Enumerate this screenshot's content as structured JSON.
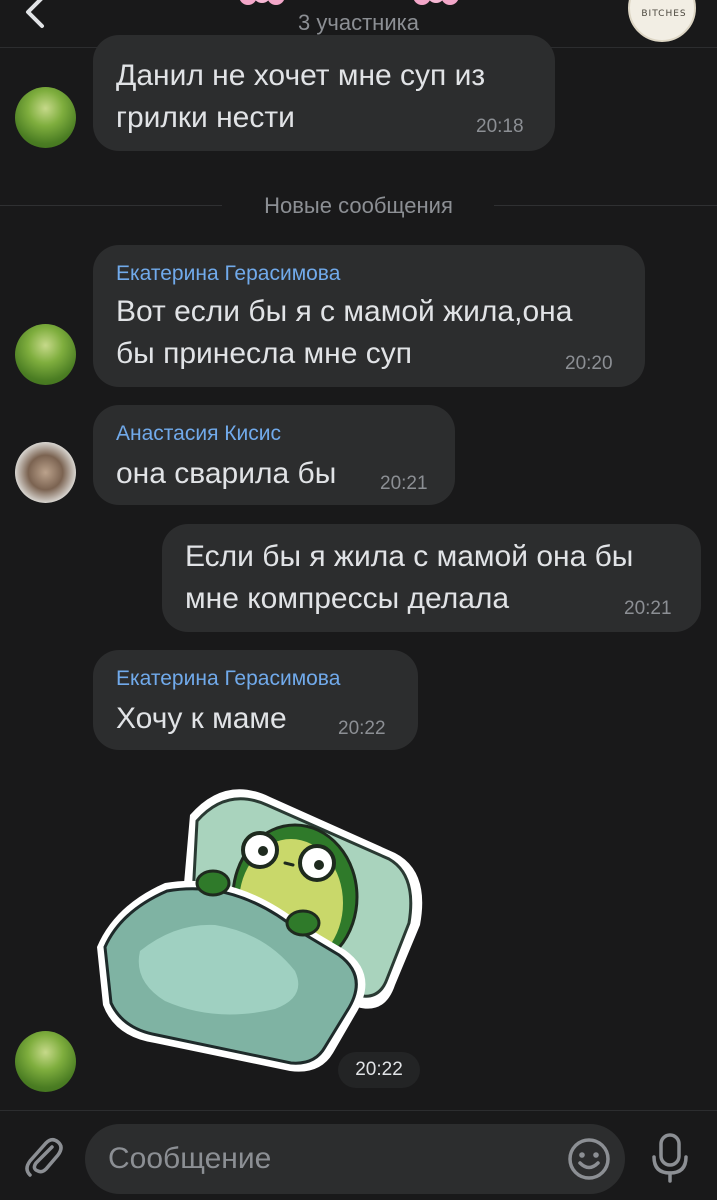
{
  "header": {
    "subtitle": "3 участника",
    "avatar_text": "BITCHES",
    "back_icon": "chevron-left-icon"
  },
  "divider": {
    "label": "Новые сообщения"
  },
  "messages": [
    {
      "text": "Данил не хочет мне суп из\nгрилки нести",
      "time": "20:18"
    },
    {
      "sender": "Екатерина Герасимова",
      "text": "Вот если бы я с мамой жила,она\nбы принесла мне суп",
      "time": "20:20"
    },
    {
      "sender": "Анастасия Кисис",
      "text": "она сварила бы",
      "time": "20:21"
    },
    {
      "text": "Если бы я жила с мамой она бы\nмне компрессы делала",
      "time": "20:21"
    },
    {
      "sender": "Екатерина Герасимова",
      "text": "Хочу к маме",
      "time": "20:22"
    },
    {
      "sticker": "avocado-in-bed",
      "time": "20:22"
    }
  ],
  "composer": {
    "placeholder": "Сообщение",
    "attach_icon": "paperclip-icon",
    "emoji_icon": "smile-icon",
    "mic_icon": "microphone-icon"
  },
  "colors": {
    "background": "#19191a",
    "bubble": "#2c2d2e",
    "sender_name": "#71aaeb",
    "text": "#e1e3e6",
    "secondary": "#8c8f94"
  }
}
